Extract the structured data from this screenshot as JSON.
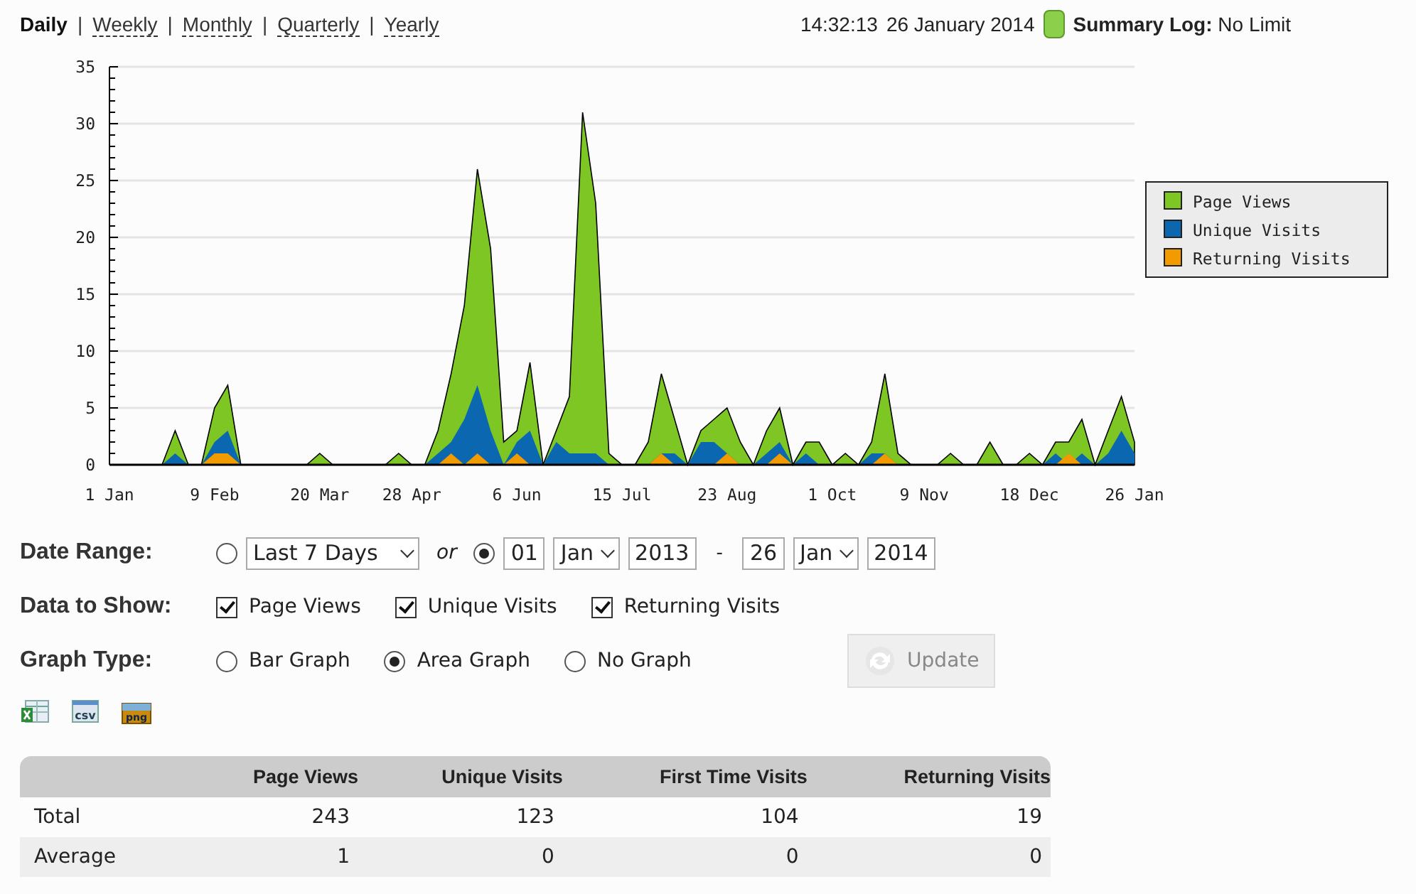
{
  "nav": {
    "periods": [
      {
        "label": "Daily",
        "selected": true
      },
      {
        "label": "Weekly",
        "selected": false
      },
      {
        "label": "Monthly",
        "selected": false
      },
      {
        "label": "Quarterly",
        "selected": false
      },
      {
        "label": "Yearly",
        "selected": false
      }
    ],
    "time": "14:32:13",
    "date": "26 January 2014",
    "summary": "**Summary Log:** No Limit",
    "separator": "|"
  },
  "chart": {
    "chart_data": {
      "type": "area",
      "stacked": false,
      "categories": [
        "1 Jan",
        null,
        null,
        null,
        null,
        null,
        null,
        null,
        "9 Feb",
        null,
        null,
        null,
        null,
        null,
        null,
        null,
        "20 Mar",
        null,
        null,
        null,
        null,
        null,
        null,
        "28 Apr",
        null,
        null,
        null,
        null,
        null,
        null,
        null,
        "6 Jun",
        null,
        null,
        null,
        null,
        null,
        null,
        null,
        "15 Jul",
        null,
        null,
        null,
        null,
        null,
        null,
        null,
        "23 Aug",
        null,
        null,
        null,
        null,
        null,
        null,
        null,
        "1 Oct",
        null,
        null,
        null,
        null,
        null,
        null,
        "9 Nov",
        null,
        null,
        null,
        null,
        null,
        null,
        null,
        "18 Dec",
        null,
        null,
        null,
        null,
        null,
        null,
        null,
        "26 Jan"
      ],
      "series": [
        {
          "name": "Page Views",
          "color": "#7dc623",
          "values": [
            0,
            0,
            0,
            0,
            0,
            3,
            0,
            0,
            5,
            7,
            0,
            0,
            0,
            0,
            0,
            0,
            1,
            0,
            0,
            0,
            0,
            0,
            1,
            0,
            0,
            3,
            8,
            14,
            26,
            19,
            2,
            3,
            9,
            0,
            3,
            6,
            31,
            23,
            1,
            0,
            0,
            2,
            8,
            4,
            0,
            3,
            4,
            5,
            2,
            0,
            3,
            5,
            0,
            2,
            2,
            0,
            1,
            0,
            2,
            8,
            1,
            0,
            0,
            0,
            1,
            0,
            0,
            2,
            0,
            0,
            1,
            0,
            2,
            2,
            4,
            0,
            3,
            6,
            2
          ]
        },
        {
          "name": "Unique Visits",
          "color": "#0b67b0",
          "values": [
            0,
            0,
            0,
            0,
            0,
            1,
            0,
            0,
            2,
            3,
            0,
            0,
            0,
            0,
            0,
            0,
            0,
            0,
            0,
            0,
            0,
            0,
            0,
            0,
            0,
            1,
            2,
            4,
            7,
            3,
            0,
            2,
            3,
            0,
            2,
            1,
            1,
            1,
            0,
            0,
            0,
            0,
            1,
            1,
            0,
            2,
            2,
            1,
            0,
            0,
            1,
            2,
            0,
            1,
            0,
            0,
            0,
            0,
            1,
            1,
            0,
            0,
            0,
            0,
            0,
            0,
            0,
            0,
            0,
            0,
            0,
            0,
            1,
            0,
            1,
            0,
            1,
            3,
            1
          ]
        },
        {
          "name": "Returning Visits",
          "color": "#f29b00",
          "values": [
            0,
            0,
            0,
            0,
            0,
            0,
            0,
            0,
            1,
            1,
            0,
            0,
            0,
            0,
            0,
            0,
            0,
            0,
            0,
            0,
            0,
            0,
            0,
            0,
            0,
            0,
            1,
            0,
            1,
            0,
            0,
            1,
            0,
            0,
            0,
            0,
            0,
            0,
            0,
            0,
            0,
            0,
            1,
            0,
            0,
            0,
            0,
            1,
            0,
            0,
            0,
            1,
            0,
            0,
            0,
            0,
            0,
            0,
            0,
            1,
            0,
            0,
            0,
            0,
            0,
            0,
            0,
            0,
            0,
            0,
            0,
            0,
            0,
            1,
            0,
            0,
            0,
            0,
            0
          ]
        }
      ],
      "ylim": [
        0,
        35
      ],
      "grid": true,
      "legend": true,
      "yticks": [
        0,
        5,
        10,
        15,
        20,
        25,
        30,
        35
      ]
    }
  },
  "form": {
    "date_range": {
      "label": "Date Range:",
      "preset_selected": false,
      "preset": "Last 7 Days",
      "or": "or",
      "custom_selected": true,
      "from_day": "01",
      "from_month": "Jan",
      "from_year": "2013",
      "dash": "-",
      "to_day": "26",
      "to_month": "Jan",
      "to_year": "2014"
    },
    "data_to_show": {
      "label": "Data to Show:",
      "options": [
        {
          "label": "Page Views",
          "checked": true
        },
        {
          "label": "Unique Visits",
          "checked": true
        },
        {
          "label": "Returning Visits",
          "checked": true
        }
      ]
    },
    "graph_type": {
      "label": "Graph Type:",
      "options": [
        {
          "label": "Bar Graph",
          "selected": false
        },
        {
          "label": "Area Graph",
          "selected": true
        },
        {
          "label": "No Graph",
          "selected": false
        }
      ]
    },
    "update": {
      "label": "Update",
      "disabled": true
    }
  },
  "exports": [
    {
      "kind": "excel"
    },
    {
      "kind": "csv",
      "label": "csv"
    },
    {
      "kind": "png",
      "label": "png"
    }
  ],
  "table": {
    "columns": [
      "Page Views",
      "Unique Visits",
      "First Time Visits",
      "Returning Visits"
    ],
    "rows": [
      {
        "label": "Total",
        "cells": [
          "243",
          "123",
          "104",
          "19"
        ]
      },
      {
        "label": "Average",
        "cells": [
          "1",
          "0",
          "0",
          "0"
        ]
      }
    ]
  }
}
